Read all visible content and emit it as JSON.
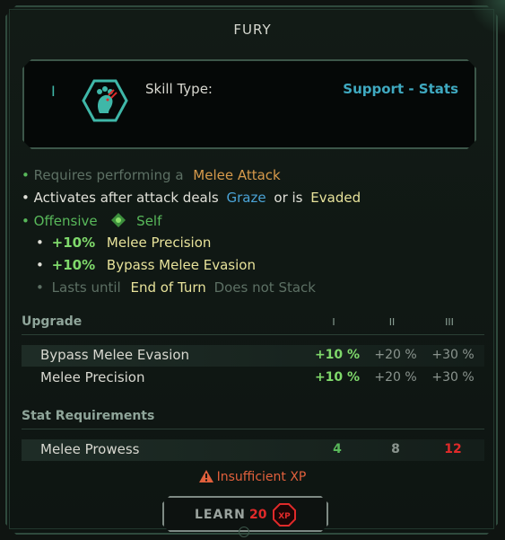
{
  "title": "FURY",
  "header": {
    "rank": "I",
    "skill_icon": "bear-claw-icon",
    "skill_type_label": "Skill Type:",
    "skill_type_value": "Support - Stats"
  },
  "desc": {
    "l1_a": "Requires performing a",
    "l1_b": "Melee Attack",
    "l2_a": "Activates after attack deals",
    "l2_b": "Graze",
    "l2_c": "or is",
    "l2_d": "Evaded",
    "l3_a": "Offensive",
    "l3_b": "Self",
    "l4_a": "+10%",
    "l4_b": "Melee Precision",
    "l5_a": "+10%",
    "l5_b": "Bypass Melee Evasion",
    "l6_a": "Lasts until",
    "l6_b": "End of Turn",
    "l6_c": "Does not Stack"
  },
  "upgrade": {
    "heading": "Upgrade",
    "ranks": [
      "I",
      "II",
      "III"
    ],
    "rows": [
      {
        "name": "Bypass Melee Evasion",
        "v1": "+10 %",
        "v2": "+20 %",
        "v3": "+30 %"
      },
      {
        "name": "Melee Precision",
        "v1": "+10 %",
        "v2": "+20 %",
        "v3": "+30 %"
      }
    ]
  },
  "requirements": {
    "heading": "Stat Requirements",
    "rows": [
      {
        "name": "Melee Prowess",
        "v1": "4",
        "v2": "8",
        "v3": "12"
      }
    ]
  },
  "warning": "Insufficient XP",
  "learn": {
    "label": "LEARN",
    "cost": "20",
    "currency": "XP"
  },
  "colors": {
    "accent_teal": "#3fa9c0",
    "positive_green": "#7fd96b",
    "warning_red": "#e0603c",
    "cost_red": "#e02a2a"
  }
}
